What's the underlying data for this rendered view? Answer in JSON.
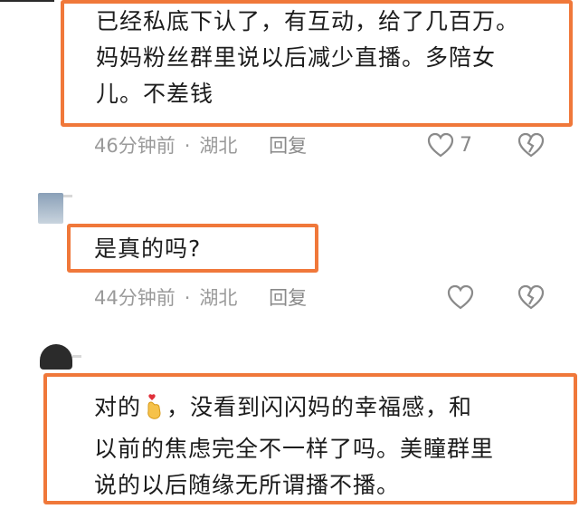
{
  "colors": {
    "highlight": "#f0783a",
    "meta": "#9a9a9a",
    "text": "#1c1c1c"
  },
  "comments": [
    {
      "lines": [
        "已经私底下认了，有互动，给了几百万。",
        "妈妈粉丝群里说以后减少直播。多陪女",
        "儿。不差钱"
      ],
      "time": "46分钟前",
      "location": "湖北",
      "reply_label": "回复",
      "like_count": "7",
      "like_icon": "heart-outline-icon",
      "dislike_icon": "broken-heart-icon"
    },
    {
      "lines": [
        "是真的吗?"
      ],
      "time": "44分钟前",
      "location": "湖北",
      "reply_label": "回复",
      "like_icon": "heart-outline-icon",
      "dislike_icon": "broken-heart-icon"
    },
    {
      "lines": [
        "对的",
        "，没看到闪闪妈的幸福感，和",
        "以前的焦虑完全不一样了吗。美瞳群里",
        "说的以后随缘无所谓播不播。"
      ],
      "emoji_icon": "finger-heart-emoji-icon"
    }
  ]
}
